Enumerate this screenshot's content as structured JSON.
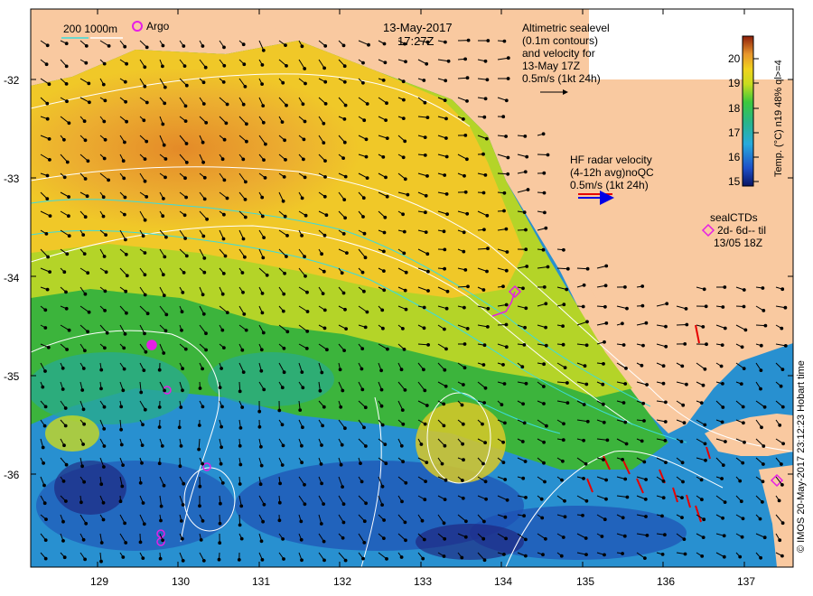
{
  "header": {
    "date": "13-May-2017",
    "time": "17:27Z",
    "scale_label": "200 1000m",
    "argo_label": "Argo"
  },
  "altimetry_note": [
    "Altimetric sealevel",
    "(0.1m contours)",
    "and velocity for",
    "13-May 17Z",
    "0.5m/s (1kt 24h)"
  ],
  "hf_radar_note": [
    "HF radar velocity",
    "(4-12h avg)noQC",
    "0.5m/s (1kt 24h)"
  ],
  "sealctd_note": [
    "sealCTDs",
    "2d- 6d-- til",
    "13/05 18Z"
  ],
  "colorbar": {
    "title": "Temp. (°C) n19 48% ql>=4",
    "ticks": [
      "20",
      "19",
      "18",
      "17",
      "16",
      "15"
    ],
    "min": 14.6,
    "max": 20.6
  },
  "axes": {
    "x_ticks": [
      "129",
      "130",
      "131",
      "132",
      "133",
      "134",
      "135",
      "136",
      "137"
    ],
    "y_ticks": [
      "-32",
      "-33",
      "-34",
      "-35",
      "-36"
    ]
  },
  "credit": "© IMOS 20-May-2017 23:12:23 Hobart time",
  "colors": {
    "land": "#f9c9a0",
    "warm": "#e8982c",
    "warm2": "#f2c030",
    "mid": "#c8d820",
    "green": "#3cb43c",
    "teal": "#28aa8c",
    "cool": "#2896d2",
    "deep": "#1e50b4",
    "navy": "#1e1e78",
    "contour_white": "#ffffff",
    "contour_cyan": "#3cdcdc",
    "argo": "#e61ee6",
    "radar_red": "#e60000",
    "radar_blue": "#0000e6"
  }
}
